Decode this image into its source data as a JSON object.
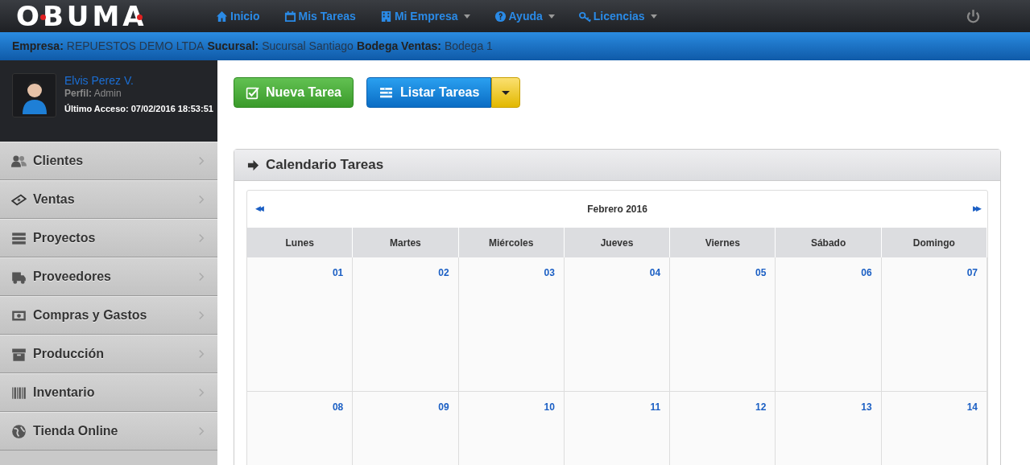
{
  "brand": {
    "logo": "OBUMA"
  },
  "nav": [
    {
      "label": "Inicio",
      "dropdown": false
    },
    {
      "label": "Mis Tareas",
      "dropdown": false
    },
    {
      "label": "Mi Empresa",
      "dropdown": true
    },
    {
      "label": "Ayuda",
      "dropdown": true
    },
    {
      "label": "Licencias",
      "dropdown": true
    }
  ],
  "info_bar": [
    {
      "label": "Empresa:",
      "value": "REPUESTOS DEMO LTDA"
    },
    {
      "label": "Sucursal:",
      "value": "Sucursal Santiago"
    },
    {
      "label": "Bodega Ventas:",
      "value": "Bodega 1"
    }
  ],
  "profile": {
    "name": "Elvis Perez V.",
    "role_label": "Perfil:",
    "role": "Admin",
    "last_access": "Último Acceso: 07/02/2016 18:53:51"
  },
  "sidebar": {
    "items": [
      {
        "label": "Clientes"
      },
      {
        "label": "Ventas"
      },
      {
        "label": "Proyectos"
      },
      {
        "label": "Proveedores"
      },
      {
        "label": "Compras y Gastos"
      },
      {
        "label": "Producción"
      },
      {
        "label": "Inventario"
      },
      {
        "label": "Tienda Online"
      }
    ]
  },
  "actions": [
    {
      "label": "Nueva Tarea",
      "kind": "success"
    },
    {
      "label": "Listar Tareas",
      "kind": "split"
    }
  ],
  "panel": {
    "title": "Calendario Tareas",
    "calendar": {
      "prev": "◀◀",
      "month": "Febrero 2016",
      "next": "▶▶",
      "weekdays": [
        "Lunes",
        "Martes",
        "Miércoles",
        "Jueves",
        "Viernes",
        "Sábado",
        "Domingo"
      ],
      "weeks": [
        [
          "01",
          "02",
          "03",
          "04",
          "05",
          "06",
          "07"
        ],
        [
          "08",
          "09",
          "10",
          "11",
          "12",
          "13",
          "14"
        ]
      ]
    }
  }
}
